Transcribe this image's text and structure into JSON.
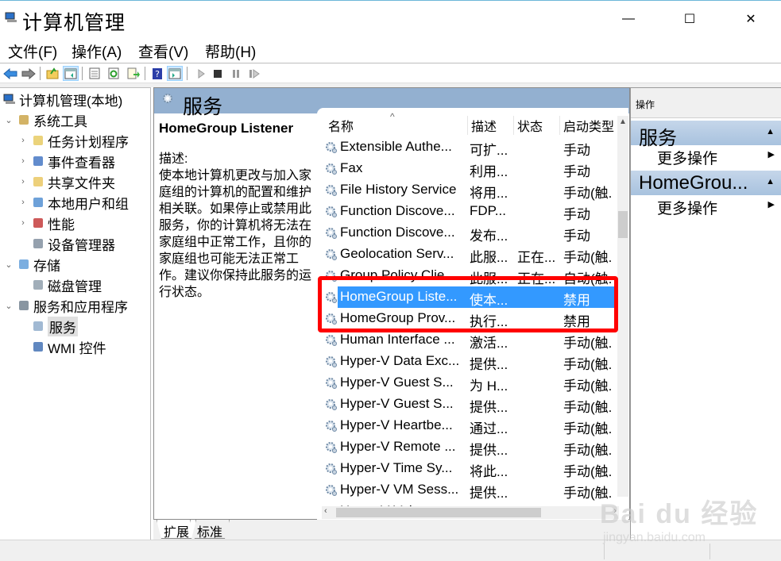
{
  "window": {
    "title": "计算机管理",
    "minimize_label": "—",
    "maximize_label": "☐",
    "close_label": "✕"
  },
  "menu": [
    "文件(F)",
    "操作(A)",
    "查看(V)",
    "帮助(H)"
  ],
  "toolbar": {
    "icons": [
      "back-icon",
      "forward-icon",
      "up-folder-icon",
      "show-hide-tree-icon",
      "properties-icon",
      "refresh-icon",
      "export-list-icon",
      "help-icon",
      "show-hide-action-pane-icon",
      "start-service-icon",
      "stop-service-icon",
      "pause-service-icon",
      "restart-service-icon"
    ]
  },
  "tree": {
    "root": "计算机管理(本地)",
    "items": [
      {
        "label": "系统工具",
        "level": 1,
        "expander": "expanded",
        "icon": "tools-icon"
      },
      {
        "label": "任务计划程序",
        "level": 2,
        "expander": "collapsed",
        "icon": "clock-icon"
      },
      {
        "label": "事件查看器",
        "level": 2,
        "expander": "collapsed",
        "icon": "event-viewer-icon"
      },
      {
        "label": "共享文件夹",
        "level": 2,
        "expander": "collapsed",
        "icon": "shared-folder-icon"
      },
      {
        "label": "本地用户和组",
        "level": 2,
        "expander": "collapsed",
        "icon": "users-icon"
      },
      {
        "label": "性能",
        "level": 2,
        "expander": "collapsed",
        "icon": "performance-icon"
      },
      {
        "label": "设备管理器",
        "level": 2,
        "expander": "none",
        "icon": "device-manager-icon"
      },
      {
        "label": "存储",
        "level": 1,
        "expander": "expanded",
        "icon": "storage-icon"
      },
      {
        "label": "磁盘管理",
        "level": 2,
        "expander": "none",
        "icon": "disk-icon"
      },
      {
        "label": "服务和应用程序",
        "level": 1,
        "expander": "expanded",
        "icon": "services-apps-icon"
      },
      {
        "label": "服务",
        "level": 2,
        "expander": "none",
        "icon": "gear-icon",
        "selected": true
      },
      {
        "label": "WMI 控件",
        "level": 2,
        "expander": "none",
        "icon": "wmi-icon"
      }
    ]
  },
  "center": {
    "header": "服务",
    "selected_service_name": "HomeGroup Listener",
    "desc_label": "描述:",
    "desc_text": "使本地计算机更改与加入家庭组的计算机的配置和维护相关联。如果停止或禁用此服务，你的计算机将无法在家庭组中正常工作，且你的家庭组也可能无法正常工作。建议你保持此服务的运行状态。",
    "columns": [
      "名称",
      "描述",
      "状态",
      "启动类型"
    ],
    "sort_indicator": "^",
    "rows": [
      {
        "name": "Extensible Authe...",
        "desc": "可扩...",
        "status": "",
        "startup": "手动"
      },
      {
        "name": "Fax",
        "desc": "利用...",
        "status": "",
        "startup": "手动"
      },
      {
        "name": "File History Service",
        "desc": "将用...",
        "status": "",
        "startup": "手动(触."
      },
      {
        "name": "Function Discove...",
        "desc": "FDP...",
        "status": "",
        "startup": "手动"
      },
      {
        "name": "Function Discove...",
        "desc": "发布...",
        "status": "",
        "startup": "手动"
      },
      {
        "name": "Geolocation Serv...",
        "desc": "此服...",
        "status": "正在...",
        "startup": "手动(触."
      },
      {
        "name": "Group Policy Clie...",
        "desc": "此服...",
        "status": "正在...",
        "startup": "自动(触."
      },
      {
        "name": "HomeGroup Liste...",
        "desc": "使本...",
        "status": "",
        "startup": "禁用",
        "selected": true
      },
      {
        "name": "HomeGroup Prov...",
        "desc": "执行...",
        "status": "",
        "startup": "禁用"
      },
      {
        "name": "Human Interface ...",
        "desc": "激活...",
        "status": "",
        "startup": "手动(触."
      },
      {
        "name": "Hyper-V Data Exc...",
        "desc": "提供...",
        "status": "",
        "startup": "手动(触."
      },
      {
        "name": "Hyper-V Guest S...",
        "desc": "为 H...",
        "status": "",
        "startup": "手动(触."
      },
      {
        "name": "Hyper-V Guest S...",
        "desc": "提供...",
        "status": "",
        "startup": "手动(触."
      },
      {
        "name": "Hyper-V Heartbe...",
        "desc": "通过...",
        "status": "",
        "startup": "手动(触."
      },
      {
        "name": "Hyper-V Remote ...",
        "desc": "提供...",
        "status": "",
        "startup": "手动(触."
      },
      {
        "name": "Hyper-V Time Sy...",
        "desc": "将此...",
        "status": "",
        "startup": "手动(触."
      },
      {
        "name": "Hyper-V VM Sess...",
        "desc": "提供...",
        "status": "",
        "startup": "手动(触."
      },
      {
        "name": "Hyper-V Volume ...",
        "desc": "协调...",
        "status": "",
        "startup": "手动(触."
      }
    ],
    "tabs": [
      "扩展",
      "标准"
    ],
    "active_tab": "扩展"
  },
  "actions": {
    "header": "操作",
    "sections": [
      {
        "title": "服务",
        "items": [
          "更多操作"
        ]
      },
      {
        "title": "HomeGrou...",
        "items": [
          "更多操作"
        ]
      }
    ]
  },
  "watermark": {
    "logo": "Bai du 经验",
    "url": "jingyan.baidu.com"
  },
  "colors": {
    "selection": "#3399ff",
    "section_header": "#93b0d0",
    "highlight_box": "#ff0000"
  }
}
